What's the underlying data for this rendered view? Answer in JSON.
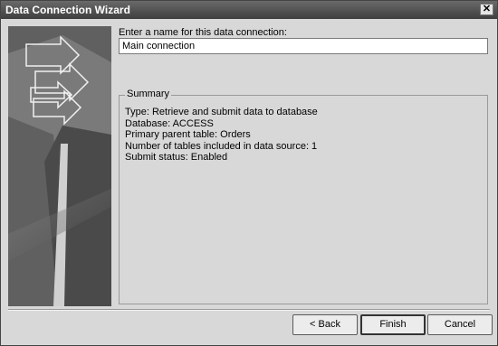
{
  "window": {
    "title": "Data Connection Wizard",
    "close_glyph": "✕"
  },
  "name_section": {
    "label": "Enter a name for this data connection:",
    "value": "Main connection"
  },
  "summary": {
    "legend": "Summary",
    "lines": [
      "Type: Retrieve and submit data to database",
      "Database: ACCESS",
      "Primary parent table: Orders",
      "Number of tables included in data source: 1",
      "Submit status: Enabled"
    ]
  },
  "buttons": {
    "back": "< Back",
    "finish": "Finish",
    "cancel": "Cancel"
  },
  "side_art": {
    "icon": "wizard-arrows-graphic"
  }
}
